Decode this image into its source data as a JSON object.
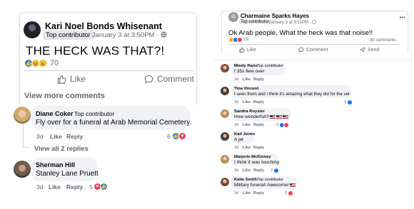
{
  "left_post": {
    "author": "Kari Noel Bonds Whisenant",
    "badge": "Top contributor",
    "meta": "· January 3 at 3:50PM ·",
    "text": "THE HECK WAS THAT?!",
    "reaction_count": "70",
    "reactions": [
      "like",
      "haha",
      "wow"
    ],
    "like_label": "Like",
    "comment_label": "Comment",
    "view_more": "View more comments"
  },
  "left_comments": [
    {
      "name": "Diane Coker",
      "badge": "Top contributor",
      "text": "Fly over for a funeral at Arab Memorial Cemetery.",
      "time": "3d",
      "like": "Like",
      "reply": "Reply",
      "count": "6",
      "reactions": [
        "like",
        "love"
      ]
    },
    {
      "name": "Sherman Hill",
      "badge": "",
      "text": "Stanley Lane Pruett",
      "time": "3d",
      "like": "Like",
      "reply": "Reply",
      "count": "5",
      "reactions": [
        "love",
        "like"
      ]
    }
  ],
  "view_replies": "View all 2 replies",
  "right_post": {
    "author": "Charmaine Sparks Hayes",
    "badge": "Top contributor",
    "meta": "· January 3 at 3:51PM ·",
    "text": "Ok Arab people. What the heck was that noise!!",
    "reaction_count": "29",
    "comments_count": "30 comments",
    "like_label": "Like",
    "comment_label": "Comment",
    "send_label": "Send"
  },
  "right_comments": [
    {
      "name": "Mindy Paris",
      "badge": "Top contributor",
      "text": "f 35s flew over",
      "time": "3d",
      "like": "Like",
      "reply": "Reply",
      "count": "",
      "flags": 0
    },
    {
      "name": "Tina Vincent",
      "badge": "",
      "text": "I seen them and I think it's amazing what they did for the vet",
      "time": "3d",
      "like": "Like",
      "reply": "Reply",
      "count": "3",
      "flags": 0
    },
    {
      "name": "Sandra Royster",
      "badge": "",
      "text": "How wonderful!!!",
      "time": "3d",
      "like": "Like",
      "reply": "Reply",
      "count": "3",
      "flags": 3
    },
    {
      "name": "Kati Jones",
      "badge": "",
      "text": "A jet",
      "time": "3d",
      "like": "Like",
      "reply": "Reply",
      "count": "",
      "flags": 0
    },
    {
      "name": "Marjorie McKinney",
      "badge": "",
      "text": "I think it was touching",
      "time": "3d",
      "like": "Like",
      "reply": "Reply",
      "count": "2",
      "flags": 0
    },
    {
      "name": "Katie Smith",
      "badge": "Top contributor",
      "text": "Military funeral! Awesome!",
      "time": "3d",
      "like": "Like",
      "reply": "Reply",
      "count": "2",
      "flags": 1
    }
  ],
  "colors": {
    "like": "#1877f2",
    "love": "#f33e58",
    "haha": "#f7b125",
    "text_secondary": "#65676b",
    "bubble": "#f0f2f5"
  }
}
